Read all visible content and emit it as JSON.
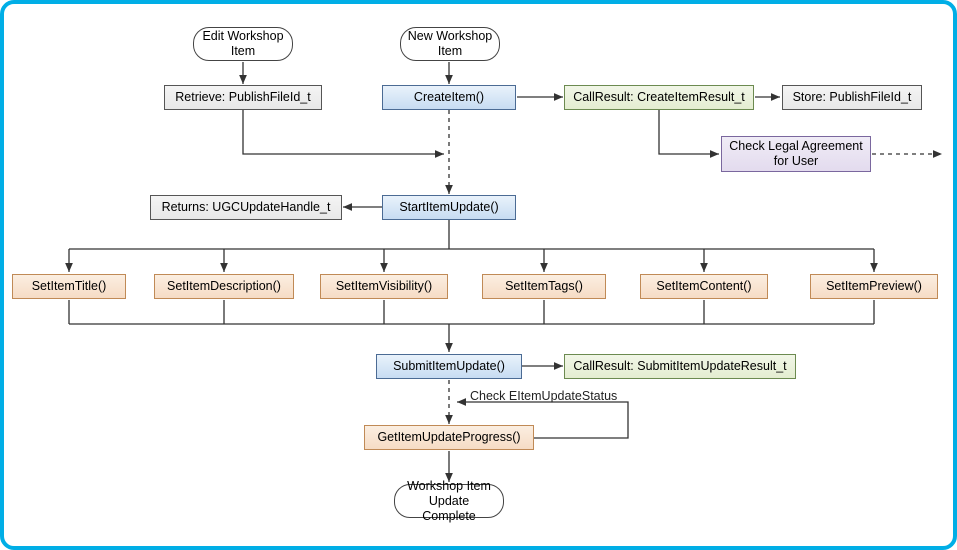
{
  "nodes": {
    "editWorkshop": "Edit Workshop\nItem",
    "newWorkshop": "New Workshop\nItem",
    "retrieve": "Retrieve: PublishFileId_t",
    "createItem": "CreateItem()",
    "callResultCreate": "CallResult: CreateItemResult_t",
    "storePublish": "Store: PublishFileId_t",
    "checkLegal": "Check Legal Agreement\nfor User",
    "returnsHandle": "Returns: UGCUpdateHandle_t",
    "startItemUpdate": "StartItemUpdate()",
    "setTitle": "SetItemTitle()",
    "setDesc": "SetItemDescription()",
    "setVis": "SetItemVisibility()",
    "setTags": "SetItemTags()",
    "setContent": "SetItemContent()",
    "setPreview": "SetItemPreview()",
    "submitUpdate": "SubmitItemUpdate()",
    "callResultSubmit": "CallResult: SubmitItemUpdateResult_t",
    "checkStatusLabel": "Check EItemUpdateStatus",
    "getProgress": "GetItemUpdateProgress()",
    "complete": "Workshop Item\nUpdate Complete"
  }
}
